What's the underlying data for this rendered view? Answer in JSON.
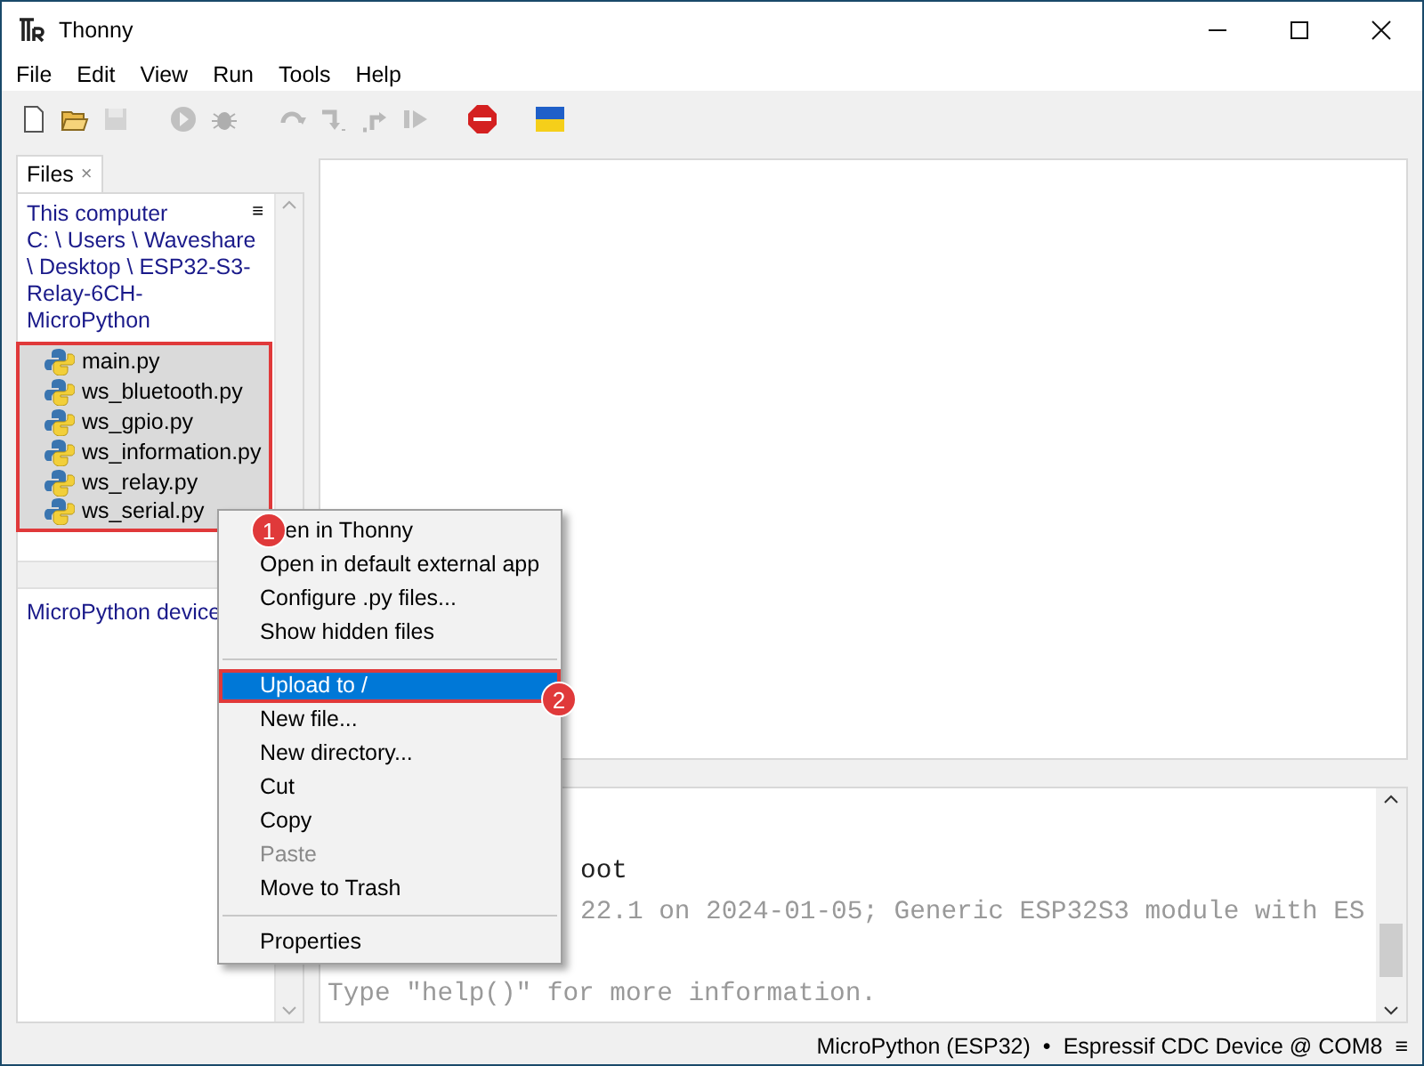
{
  "window": {
    "title": "Thonny"
  },
  "menu_bar": [
    "File",
    "Edit",
    "View",
    "Run",
    "Tools",
    "Help"
  ],
  "toolbar": [
    {
      "kind": "new",
      "disabled": false
    },
    {
      "kind": "open",
      "disabled": false
    },
    {
      "kind": "save",
      "disabled": true
    },
    {
      "kind": "run",
      "disabled": true
    },
    {
      "kind": "debug",
      "disabled": true
    },
    {
      "kind": "step-over",
      "disabled": true
    },
    {
      "kind": "step-into",
      "disabled": true
    },
    {
      "kind": "step-out",
      "disabled": true
    },
    {
      "kind": "resume",
      "disabled": true
    },
    {
      "kind": "stop",
      "disabled": false
    },
    {
      "kind": "flag",
      "disabled": false
    }
  ],
  "files_panel": {
    "tab": "Files",
    "tab_close": "×",
    "header": "This computer",
    "header_menu": "≡",
    "path": "C: \\ Users \\ Waveshare \\ Desktop \\ ESP32-S3-Relay-6CH-MicroPython",
    "files": [
      {
        "name": "main.py",
        "selected": true
      },
      {
        "name": "ws_bluetooth.py",
        "selected": true
      },
      {
        "name": "ws_gpio.py",
        "selected": true
      },
      {
        "name": "ws_information.py",
        "selected": true
      },
      {
        "name": "ws_relay.py",
        "selected": true
      },
      {
        "name": "ws_serial.py",
        "selected": true
      }
    ],
    "device_header": "MicroPython device"
  },
  "shell": {
    "lines": [
      "oot",
      "22.1 on 2024-01-05; Generic ESP32S3 module with ES",
      "Type \"help()\" for more information."
    ]
  },
  "context_menu": {
    "items": [
      {
        "kind": "item",
        "label": "en in Thonny",
        "disabled": false,
        "selected": false
      },
      {
        "kind": "item",
        "label": "Open in default external app",
        "disabled": false,
        "selected": false
      },
      {
        "kind": "item",
        "label": "Configure .py files...",
        "disabled": false,
        "selected": false
      },
      {
        "kind": "item",
        "label": "Show hidden files",
        "disabled": false,
        "selected": false
      },
      {
        "kind": "separator"
      },
      {
        "kind": "item",
        "label": "Upload to /",
        "disabled": false,
        "selected": true
      },
      {
        "kind": "item",
        "label": "New file...",
        "disabled": false,
        "selected": false
      },
      {
        "kind": "item",
        "label": "New directory...",
        "disabled": false,
        "selected": false
      },
      {
        "kind": "item",
        "label": "Cut",
        "disabled": false,
        "selected": false
      },
      {
        "kind": "item",
        "label": "Copy",
        "disabled": false,
        "selected": false
      },
      {
        "kind": "item",
        "label": "Paste",
        "disabled": true,
        "selected": false
      },
      {
        "kind": "item",
        "label": "Move to Trash",
        "disabled": false,
        "selected": false
      },
      {
        "kind": "separator"
      },
      {
        "kind": "item",
        "label": "Properties",
        "disabled": false,
        "selected": false
      }
    ]
  },
  "callouts": [
    "1",
    "2"
  ],
  "status_bar": {
    "interpreter": "MicroPython (ESP32)",
    "separator": "•",
    "port": "Espressif CDC Device @ COM8",
    "menu": "≡"
  }
}
